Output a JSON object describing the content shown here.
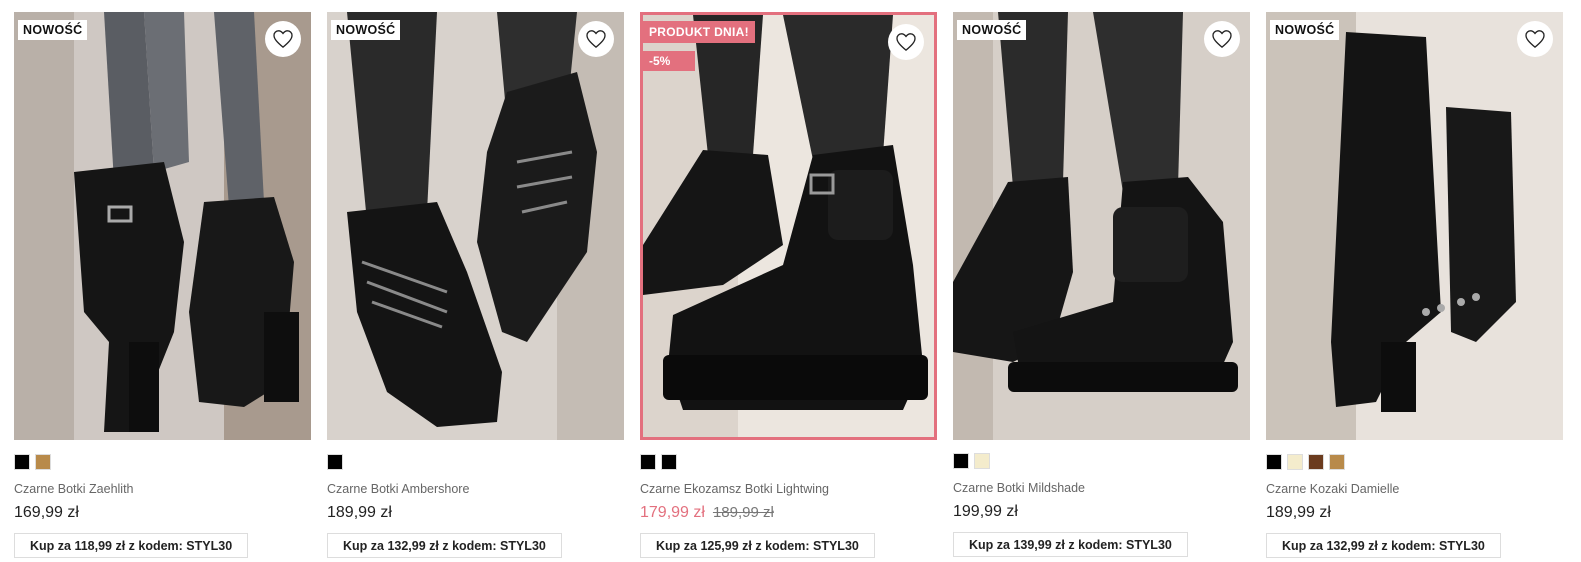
{
  "products": [
    {
      "badge": "NOWOŚĆ",
      "name": "Czarne Botki Zaehlith",
      "price": "169,99 zł",
      "promo": "Kup za 118,99 zł z kodem: STYL30",
      "swatches": [
        "#000000",
        "#b88a4a"
      ]
    },
    {
      "badge": "NOWOŚĆ",
      "name": "Czarne Botki Ambershore",
      "price": "189,99 zł",
      "promo": "Kup za 132,99 zł z kodem: STYL30",
      "swatches": [
        "#000000"
      ]
    },
    {
      "badge": "PRODUKT DNIA!",
      "discount": "-5%",
      "name": "Czarne Ekozamsz Botki Lightwing",
      "price": "179,99 zł",
      "old_price": "189,99 zł",
      "promo": "Kup za 125,99 zł z kodem: STYL30",
      "swatches": [
        "#000000",
        "#000000"
      ]
    },
    {
      "badge": "NOWOŚĆ",
      "name": "Czarne Botki Mildshade",
      "price": "199,99 zł",
      "promo": "Kup za 139,99 zł z kodem: STYL30",
      "swatches": [
        "#000000",
        "#f4eccc"
      ]
    },
    {
      "badge": "NOWOŚĆ",
      "name": "Czarne Kozaki Damielle",
      "price": "189,99 zł",
      "promo": "Kup za 132,99 zł z kodem: STYL30",
      "swatches": [
        "#000000",
        "#f4eccc",
        "#6b3b1e",
        "#b88a4a"
      ]
    }
  ],
  "colors": {
    "accent": "#e3707e",
    "text": "#222222",
    "muted": "#666666"
  }
}
